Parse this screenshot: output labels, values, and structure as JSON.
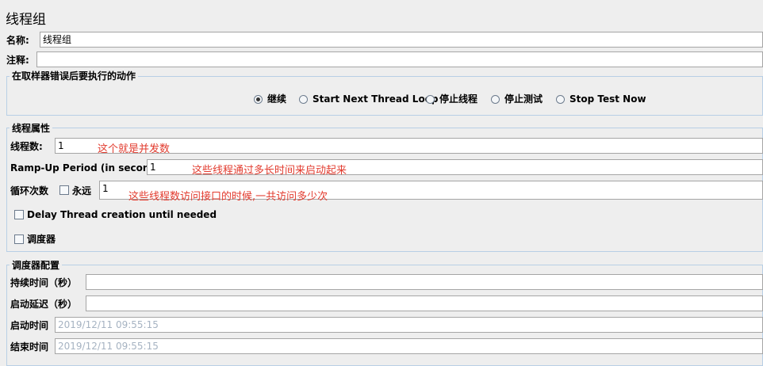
{
  "page_title": "线程组",
  "name_label": "名称:",
  "name_value": "线程组",
  "comment_label": "注释:",
  "comment_value": "",
  "error_action": {
    "title": "在取样器错误后要执行的动作",
    "options": [
      "继续",
      "Start Next Thread Loop",
      "停止线程",
      "停止测试",
      "Stop Test Now"
    ],
    "selected": "继续"
  },
  "thread_props": {
    "title": "线程属性",
    "threads_label": "线程数:",
    "threads_value": "1",
    "threads_note": "这个就是并发数",
    "rampup_label": "Ramp-Up Period (in seconds):",
    "rampup_value": "1",
    "rampup_note": "这些线程通过多长时间来启动起来",
    "loop_label": "循环次数",
    "forever_label": "永远",
    "loop_value": "1",
    "loop_note": "这些线程数访问接口的时候,一共访问多少次",
    "delay_label": "Delay Thread creation until needed",
    "scheduler_label": "调度器"
  },
  "scheduler_config": {
    "title": "调度器配置",
    "duration_label": "持续时间（秒）",
    "startup_delay_label": "启动延迟（秒）",
    "start_time_label": "启动时间",
    "start_time_value": "2019/12/11 09:55:15",
    "end_time_label": "结束时间",
    "end_time_value": "2019/12/11 09:55:15"
  }
}
